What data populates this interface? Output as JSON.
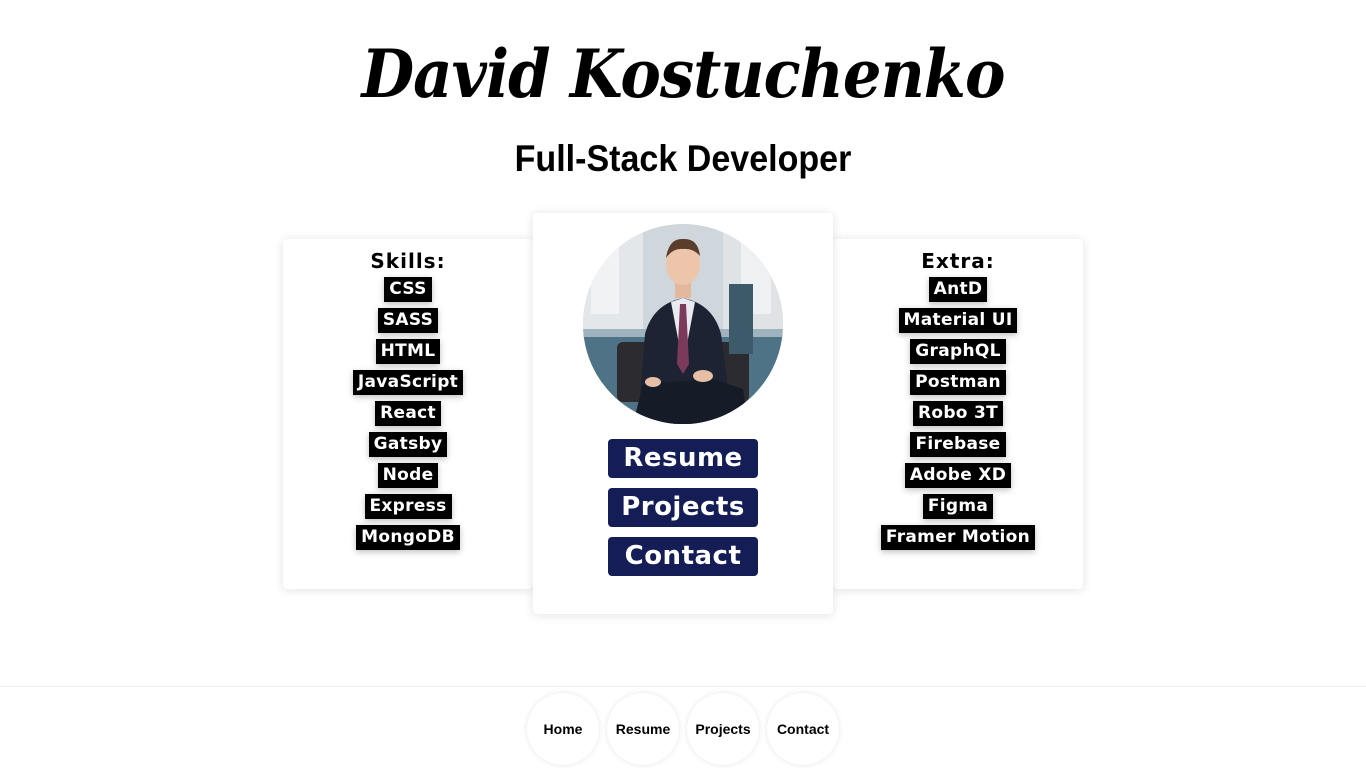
{
  "header": {
    "name": "David Kostuchenko",
    "role": "Full-Stack Developer"
  },
  "skills": {
    "heading": "Skills:",
    "items": [
      "CSS",
      "SASS",
      "HTML",
      "JavaScript",
      "React",
      "Gatsby",
      "Node",
      "Express",
      "MongoDB"
    ]
  },
  "extra": {
    "heading": "Extra:",
    "items": [
      "AntD",
      "Material UI",
      "GraphQL",
      "Postman",
      "Robo 3T",
      "Firebase",
      "Adobe XD",
      "Figma",
      "Framer Motion"
    ]
  },
  "profile": {
    "photo_alt": "profile-photo",
    "buttons": [
      "Resume",
      "Projects",
      "Contact"
    ]
  },
  "footer_nav": [
    "Home",
    "Resume",
    "Projects",
    "Contact"
  ],
  "colors": {
    "button_bg": "#151d57",
    "tag_bg": "#000000",
    "page_bg": "#ffffff"
  }
}
